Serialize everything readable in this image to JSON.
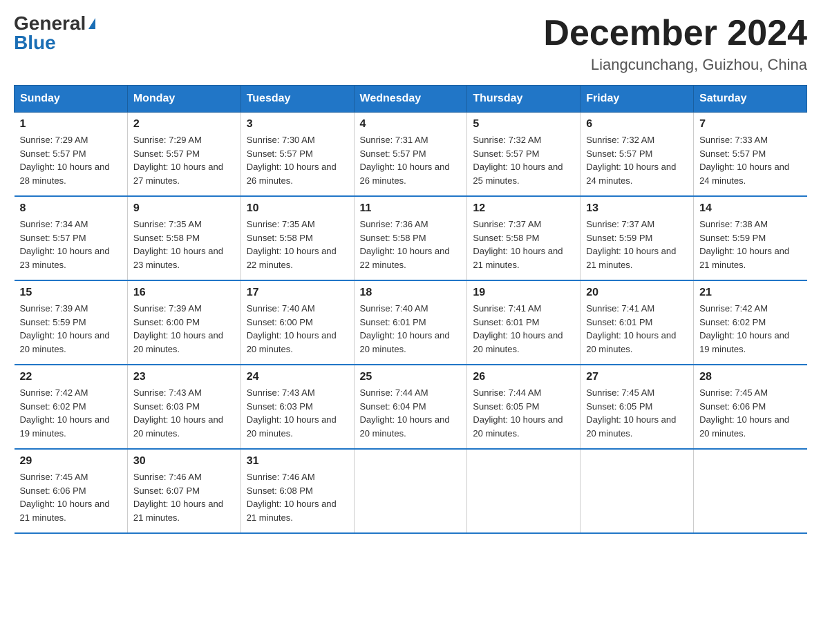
{
  "logo": {
    "general": "General",
    "blue": "Blue"
  },
  "title": "December 2024",
  "subtitle": "Liangcunchang, Guizhou, China",
  "days_of_week": [
    "Sunday",
    "Monday",
    "Tuesday",
    "Wednesday",
    "Thursday",
    "Friday",
    "Saturday"
  ],
  "weeks": [
    [
      {
        "day": "1",
        "sunrise": "7:29 AM",
        "sunset": "5:57 PM",
        "daylight": "10 hours and 28 minutes."
      },
      {
        "day": "2",
        "sunrise": "7:29 AM",
        "sunset": "5:57 PM",
        "daylight": "10 hours and 27 minutes."
      },
      {
        "day": "3",
        "sunrise": "7:30 AM",
        "sunset": "5:57 PM",
        "daylight": "10 hours and 26 minutes."
      },
      {
        "day": "4",
        "sunrise": "7:31 AM",
        "sunset": "5:57 PM",
        "daylight": "10 hours and 26 minutes."
      },
      {
        "day": "5",
        "sunrise": "7:32 AM",
        "sunset": "5:57 PM",
        "daylight": "10 hours and 25 minutes."
      },
      {
        "day": "6",
        "sunrise": "7:32 AM",
        "sunset": "5:57 PM",
        "daylight": "10 hours and 24 minutes."
      },
      {
        "day": "7",
        "sunrise": "7:33 AM",
        "sunset": "5:57 PM",
        "daylight": "10 hours and 24 minutes."
      }
    ],
    [
      {
        "day": "8",
        "sunrise": "7:34 AM",
        "sunset": "5:57 PM",
        "daylight": "10 hours and 23 minutes."
      },
      {
        "day": "9",
        "sunrise": "7:35 AM",
        "sunset": "5:58 PM",
        "daylight": "10 hours and 23 minutes."
      },
      {
        "day": "10",
        "sunrise": "7:35 AM",
        "sunset": "5:58 PM",
        "daylight": "10 hours and 22 minutes."
      },
      {
        "day": "11",
        "sunrise": "7:36 AM",
        "sunset": "5:58 PM",
        "daylight": "10 hours and 22 minutes."
      },
      {
        "day": "12",
        "sunrise": "7:37 AM",
        "sunset": "5:58 PM",
        "daylight": "10 hours and 21 minutes."
      },
      {
        "day": "13",
        "sunrise": "7:37 AM",
        "sunset": "5:59 PM",
        "daylight": "10 hours and 21 minutes."
      },
      {
        "day": "14",
        "sunrise": "7:38 AM",
        "sunset": "5:59 PM",
        "daylight": "10 hours and 21 minutes."
      }
    ],
    [
      {
        "day": "15",
        "sunrise": "7:39 AM",
        "sunset": "5:59 PM",
        "daylight": "10 hours and 20 minutes."
      },
      {
        "day": "16",
        "sunrise": "7:39 AM",
        "sunset": "6:00 PM",
        "daylight": "10 hours and 20 minutes."
      },
      {
        "day": "17",
        "sunrise": "7:40 AM",
        "sunset": "6:00 PM",
        "daylight": "10 hours and 20 minutes."
      },
      {
        "day": "18",
        "sunrise": "7:40 AM",
        "sunset": "6:01 PM",
        "daylight": "10 hours and 20 minutes."
      },
      {
        "day": "19",
        "sunrise": "7:41 AM",
        "sunset": "6:01 PM",
        "daylight": "10 hours and 20 minutes."
      },
      {
        "day": "20",
        "sunrise": "7:41 AM",
        "sunset": "6:01 PM",
        "daylight": "10 hours and 20 minutes."
      },
      {
        "day": "21",
        "sunrise": "7:42 AM",
        "sunset": "6:02 PM",
        "daylight": "10 hours and 19 minutes."
      }
    ],
    [
      {
        "day": "22",
        "sunrise": "7:42 AM",
        "sunset": "6:02 PM",
        "daylight": "10 hours and 19 minutes."
      },
      {
        "day": "23",
        "sunrise": "7:43 AM",
        "sunset": "6:03 PM",
        "daylight": "10 hours and 20 minutes."
      },
      {
        "day": "24",
        "sunrise": "7:43 AM",
        "sunset": "6:03 PM",
        "daylight": "10 hours and 20 minutes."
      },
      {
        "day": "25",
        "sunrise": "7:44 AM",
        "sunset": "6:04 PM",
        "daylight": "10 hours and 20 minutes."
      },
      {
        "day": "26",
        "sunrise": "7:44 AM",
        "sunset": "6:05 PM",
        "daylight": "10 hours and 20 minutes."
      },
      {
        "day": "27",
        "sunrise": "7:45 AM",
        "sunset": "6:05 PM",
        "daylight": "10 hours and 20 minutes."
      },
      {
        "day": "28",
        "sunrise": "7:45 AM",
        "sunset": "6:06 PM",
        "daylight": "10 hours and 20 minutes."
      }
    ],
    [
      {
        "day": "29",
        "sunrise": "7:45 AM",
        "sunset": "6:06 PM",
        "daylight": "10 hours and 21 minutes."
      },
      {
        "day": "30",
        "sunrise": "7:46 AM",
        "sunset": "6:07 PM",
        "daylight": "10 hours and 21 minutes."
      },
      {
        "day": "31",
        "sunrise": "7:46 AM",
        "sunset": "6:08 PM",
        "daylight": "10 hours and 21 minutes."
      },
      null,
      null,
      null,
      null
    ]
  ]
}
